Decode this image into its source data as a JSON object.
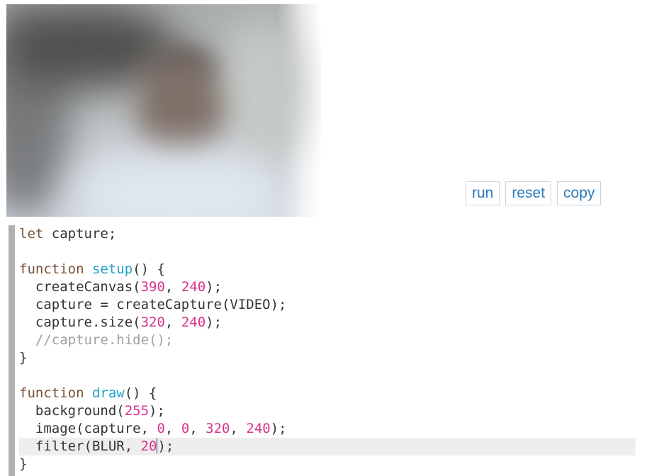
{
  "buttons": {
    "run": "run",
    "reset": "reset",
    "copy": "copy"
  },
  "code": {
    "l1": {
      "kw": "let",
      "rest": " capture;"
    },
    "l3": {
      "kw": "function",
      "space": " ",
      "fn": "setup",
      "rest": "() {"
    },
    "l4": {
      "a": "  createCanvas(",
      "n1": "390",
      "b": ", ",
      "n2": "240",
      "c": ");"
    },
    "l5": {
      "text": "  capture = createCapture(VIDEO);"
    },
    "l6": {
      "a": "  capture.size(",
      "n1": "320",
      "b": ", ",
      "n2": "240",
      "c": ");"
    },
    "l7": {
      "comment": "  //capture.hide();"
    },
    "l8": {
      "text": "}"
    },
    "l10": {
      "kw": "function",
      "space": " ",
      "fn": "draw",
      "rest": "() {"
    },
    "l11": {
      "a": "  background(",
      "n1": "255",
      "c": ");"
    },
    "l12": {
      "a": "  image(capture, ",
      "n1": "0",
      "b": ", ",
      "n2": "0",
      "d": ", ",
      "n3": "320",
      "e": ", ",
      "n4": "240",
      "c": ");"
    },
    "l13": {
      "a": "  filter(BLUR, ",
      "n1": "20",
      "c": ");"
    },
    "l14": {
      "text": "}"
    }
  },
  "colors": {
    "keyword": "#795139",
    "function_name": "#1fa1c5",
    "number": "#d9348a",
    "comment": "#a0a0a0",
    "button_text": "#2a7ab8",
    "gutter": "#b1b1b1"
  }
}
